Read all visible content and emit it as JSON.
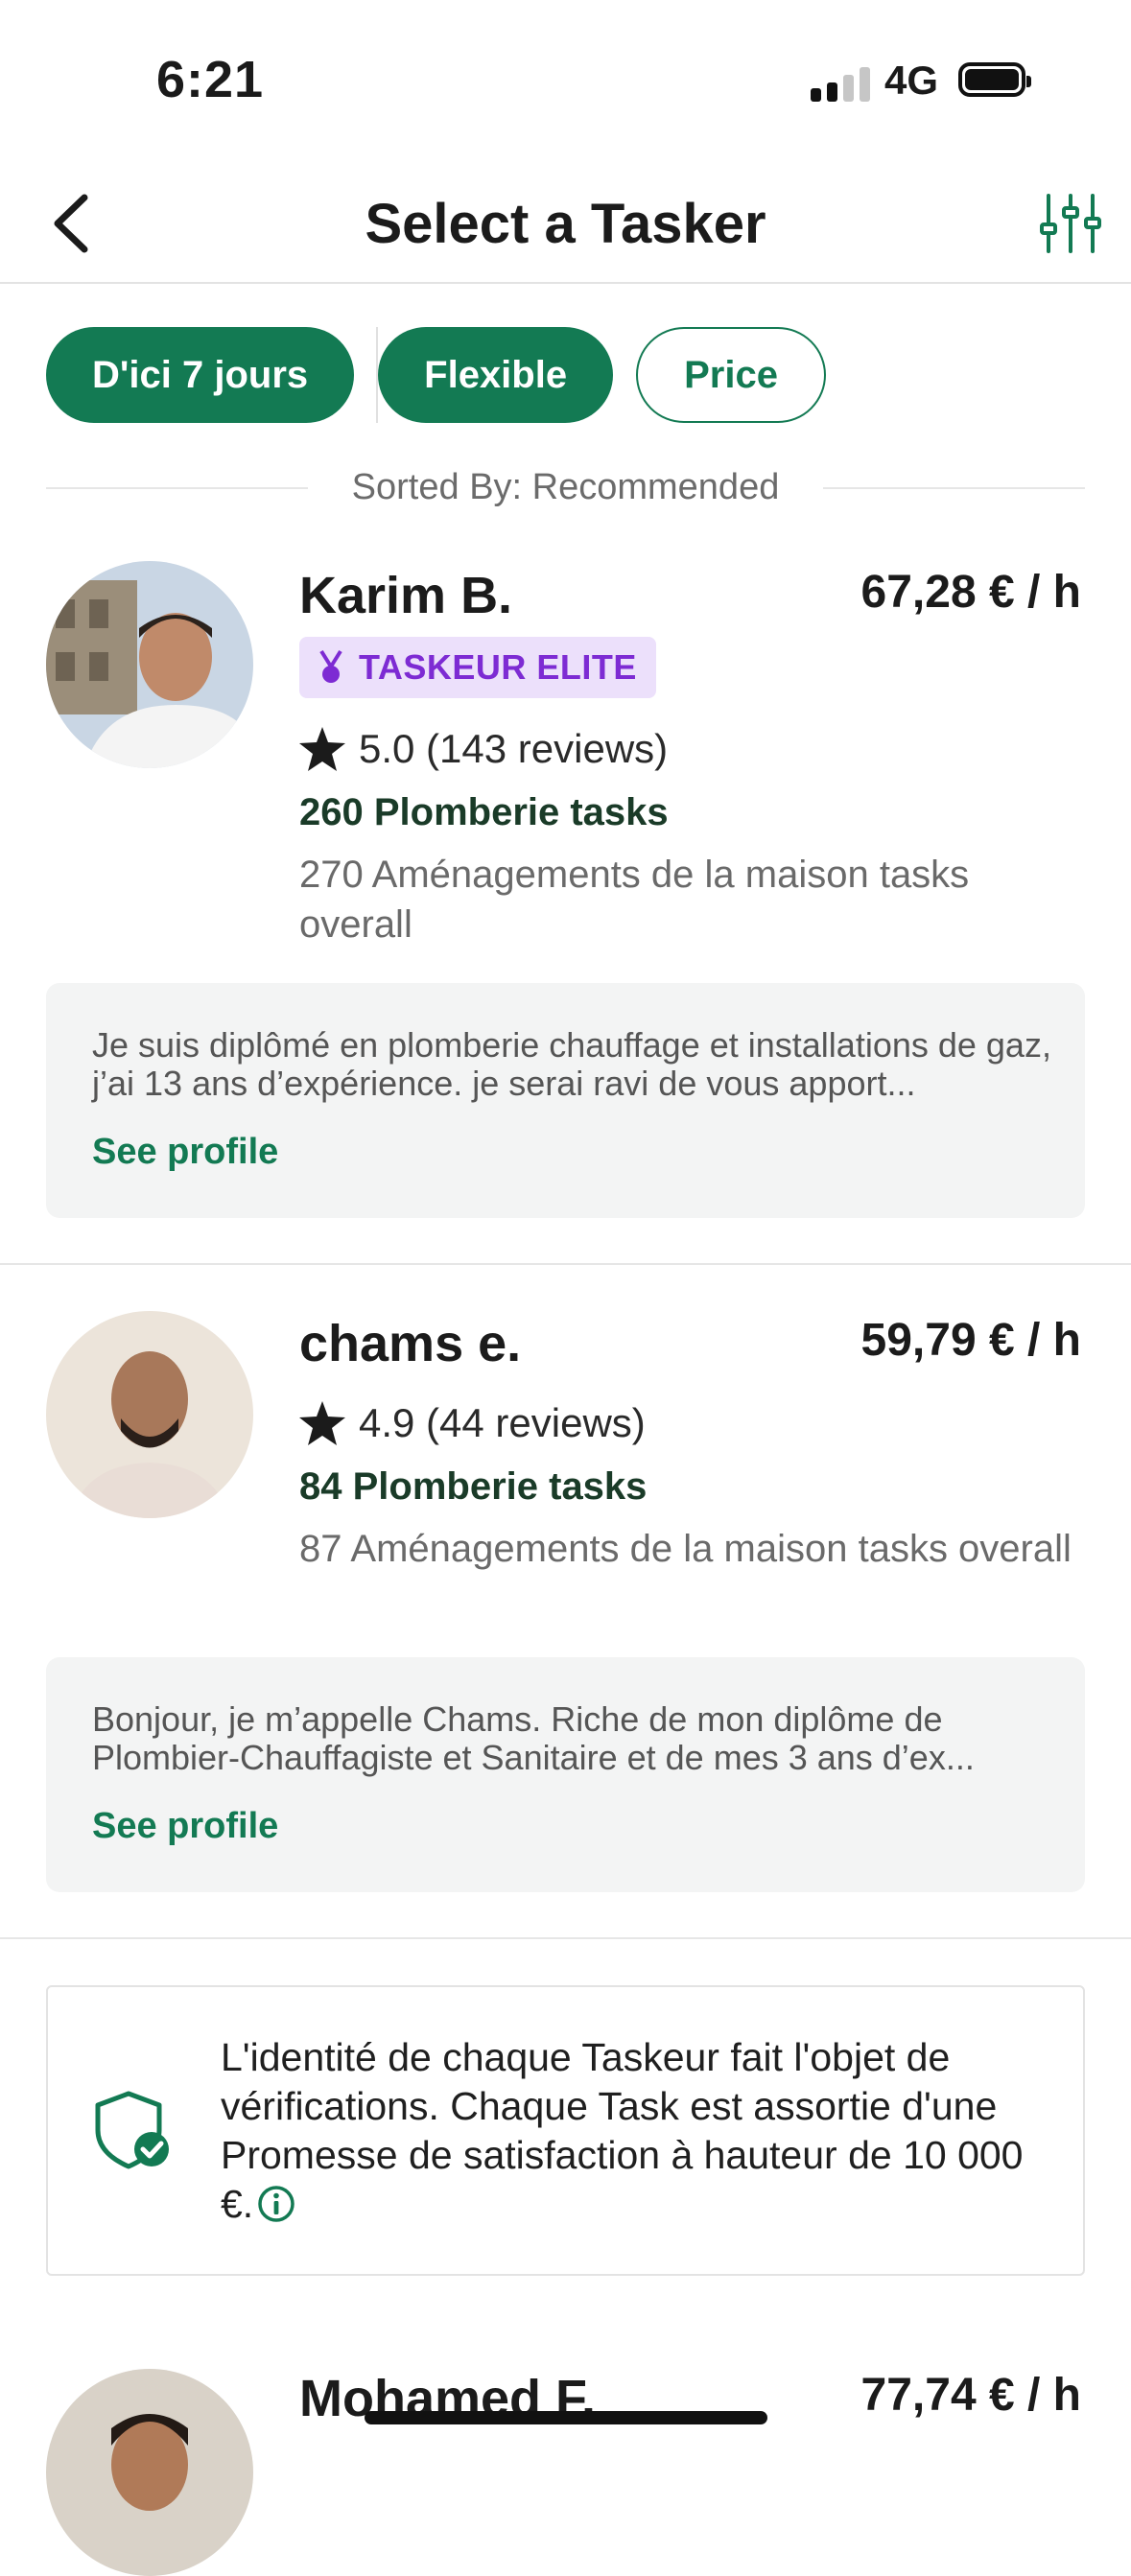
{
  "status_bar": {
    "time": "6:21",
    "network": "4G"
  },
  "header": {
    "title": "Select a Tasker"
  },
  "filters": [
    {
      "label": "D'ici 7 jours",
      "active": true
    },
    {
      "label": "Flexible",
      "active": true
    },
    {
      "label": "Price",
      "active": false
    }
  ],
  "sorted_by": "Sorted By: Recommended",
  "taskers": [
    {
      "name": "Karim B.",
      "price": "67,28 € / h",
      "badge": "TASKEUR ELITE",
      "rating": "5.0 (143 reviews)",
      "category_tasks": "260 Plomberie tasks",
      "overall_tasks": "270 Aménagements de la maison tasks overall",
      "bio": "Je suis diplômé en plomberie chauffage et installations de gaz, j’ai 13 ans d’expérience. je serai ravi de vous apport...",
      "see_profile": "See profile"
    },
    {
      "name": "chams e.",
      "price": "59,79 € / h",
      "rating": "4.9 (44 reviews)",
      "category_tasks": "84 Plomberie tasks",
      "overall_tasks": "87 Aménagements de la maison tasks overall",
      "bio": "Bonjour, je m’appelle Chams. Riche de mon diplôme de Plombier-Chauffagiste et Sanitaire et de mes 3 ans d’ex...",
      "see_profile": "See profile"
    },
    {
      "name": "Mohamed F.",
      "price": "77,74 € / h"
    }
  ],
  "trust_notice": "L'identité de chaque Taskeur fait l'objet de vérifications. Chaque Task est assortie d'une Promesse de satisfaction à hauteur de 10 000 €.",
  "colors": {
    "primary": "#137a53",
    "elite_bg": "#ece0fb",
    "elite_text": "#7d2bd3"
  }
}
